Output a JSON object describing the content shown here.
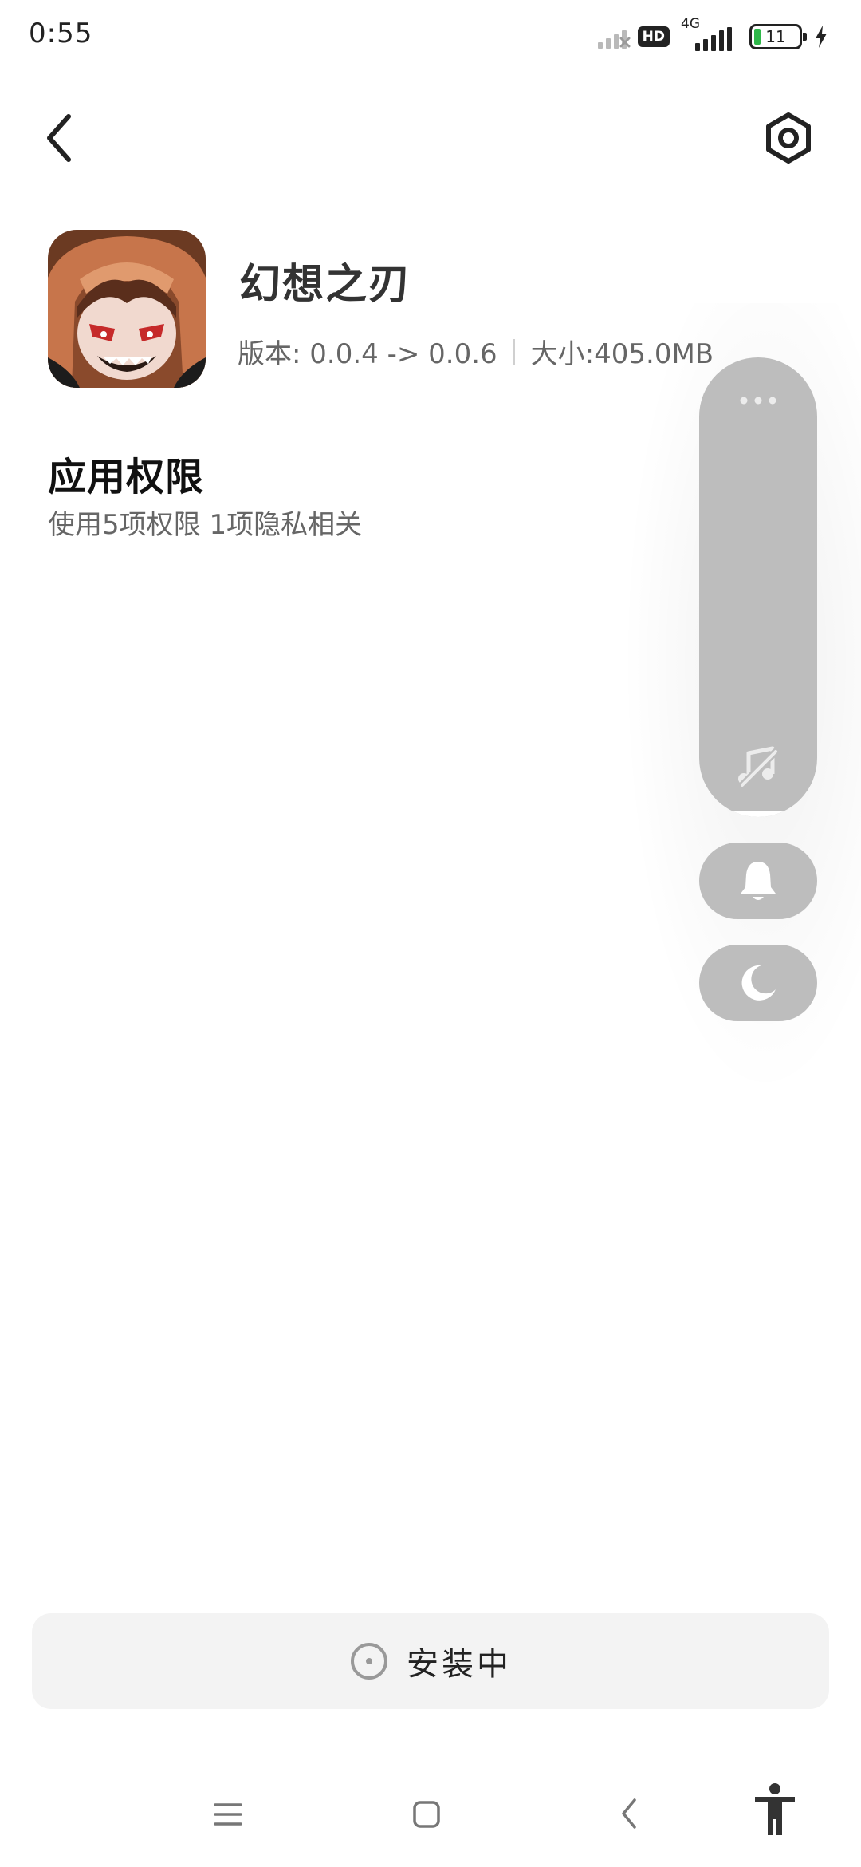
{
  "status_bar": {
    "time": "0:55",
    "hd_badge": "HD",
    "network": "4G",
    "battery_level": "11",
    "icons": [
      "signal-muted-icon",
      "hd-icon",
      "signal-4g-icon",
      "battery-icon",
      "charging-icon"
    ]
  },
  "nav": {
    "back_icon": "chevron-left-icon",
    "settings_icon": "hexagon-settings-icon"
  },
  "app": {
    "name": "幻想之刃",
    "version": "版本: 0.0.4 -> 0.0.6",
    "size": "大小:405.0MB"
  },
  "permissions": {
    "title": "应用权限",
    "summary": "使用5项权限 1项隐私相关"
  },
  "floating_panel": {
    "icons": [
      "more-dots-icon",
      "music-muted-icon",
      "bell-icon",
      "moon-icon"
    ]
  },
  "install_button": {
    "label": "安装中"
  },
  "system_nav": {
    "icons": [
      "menu-icon",
      "home-icon",
      "back-icon",
      "accessibility-icon"
    ]
  },
  "colors": {
    "panel_gray": "#bdbdbd",
    "install_bg": "#f3f3f3",
    "battery_green": "#2fb84a"
  }
}
